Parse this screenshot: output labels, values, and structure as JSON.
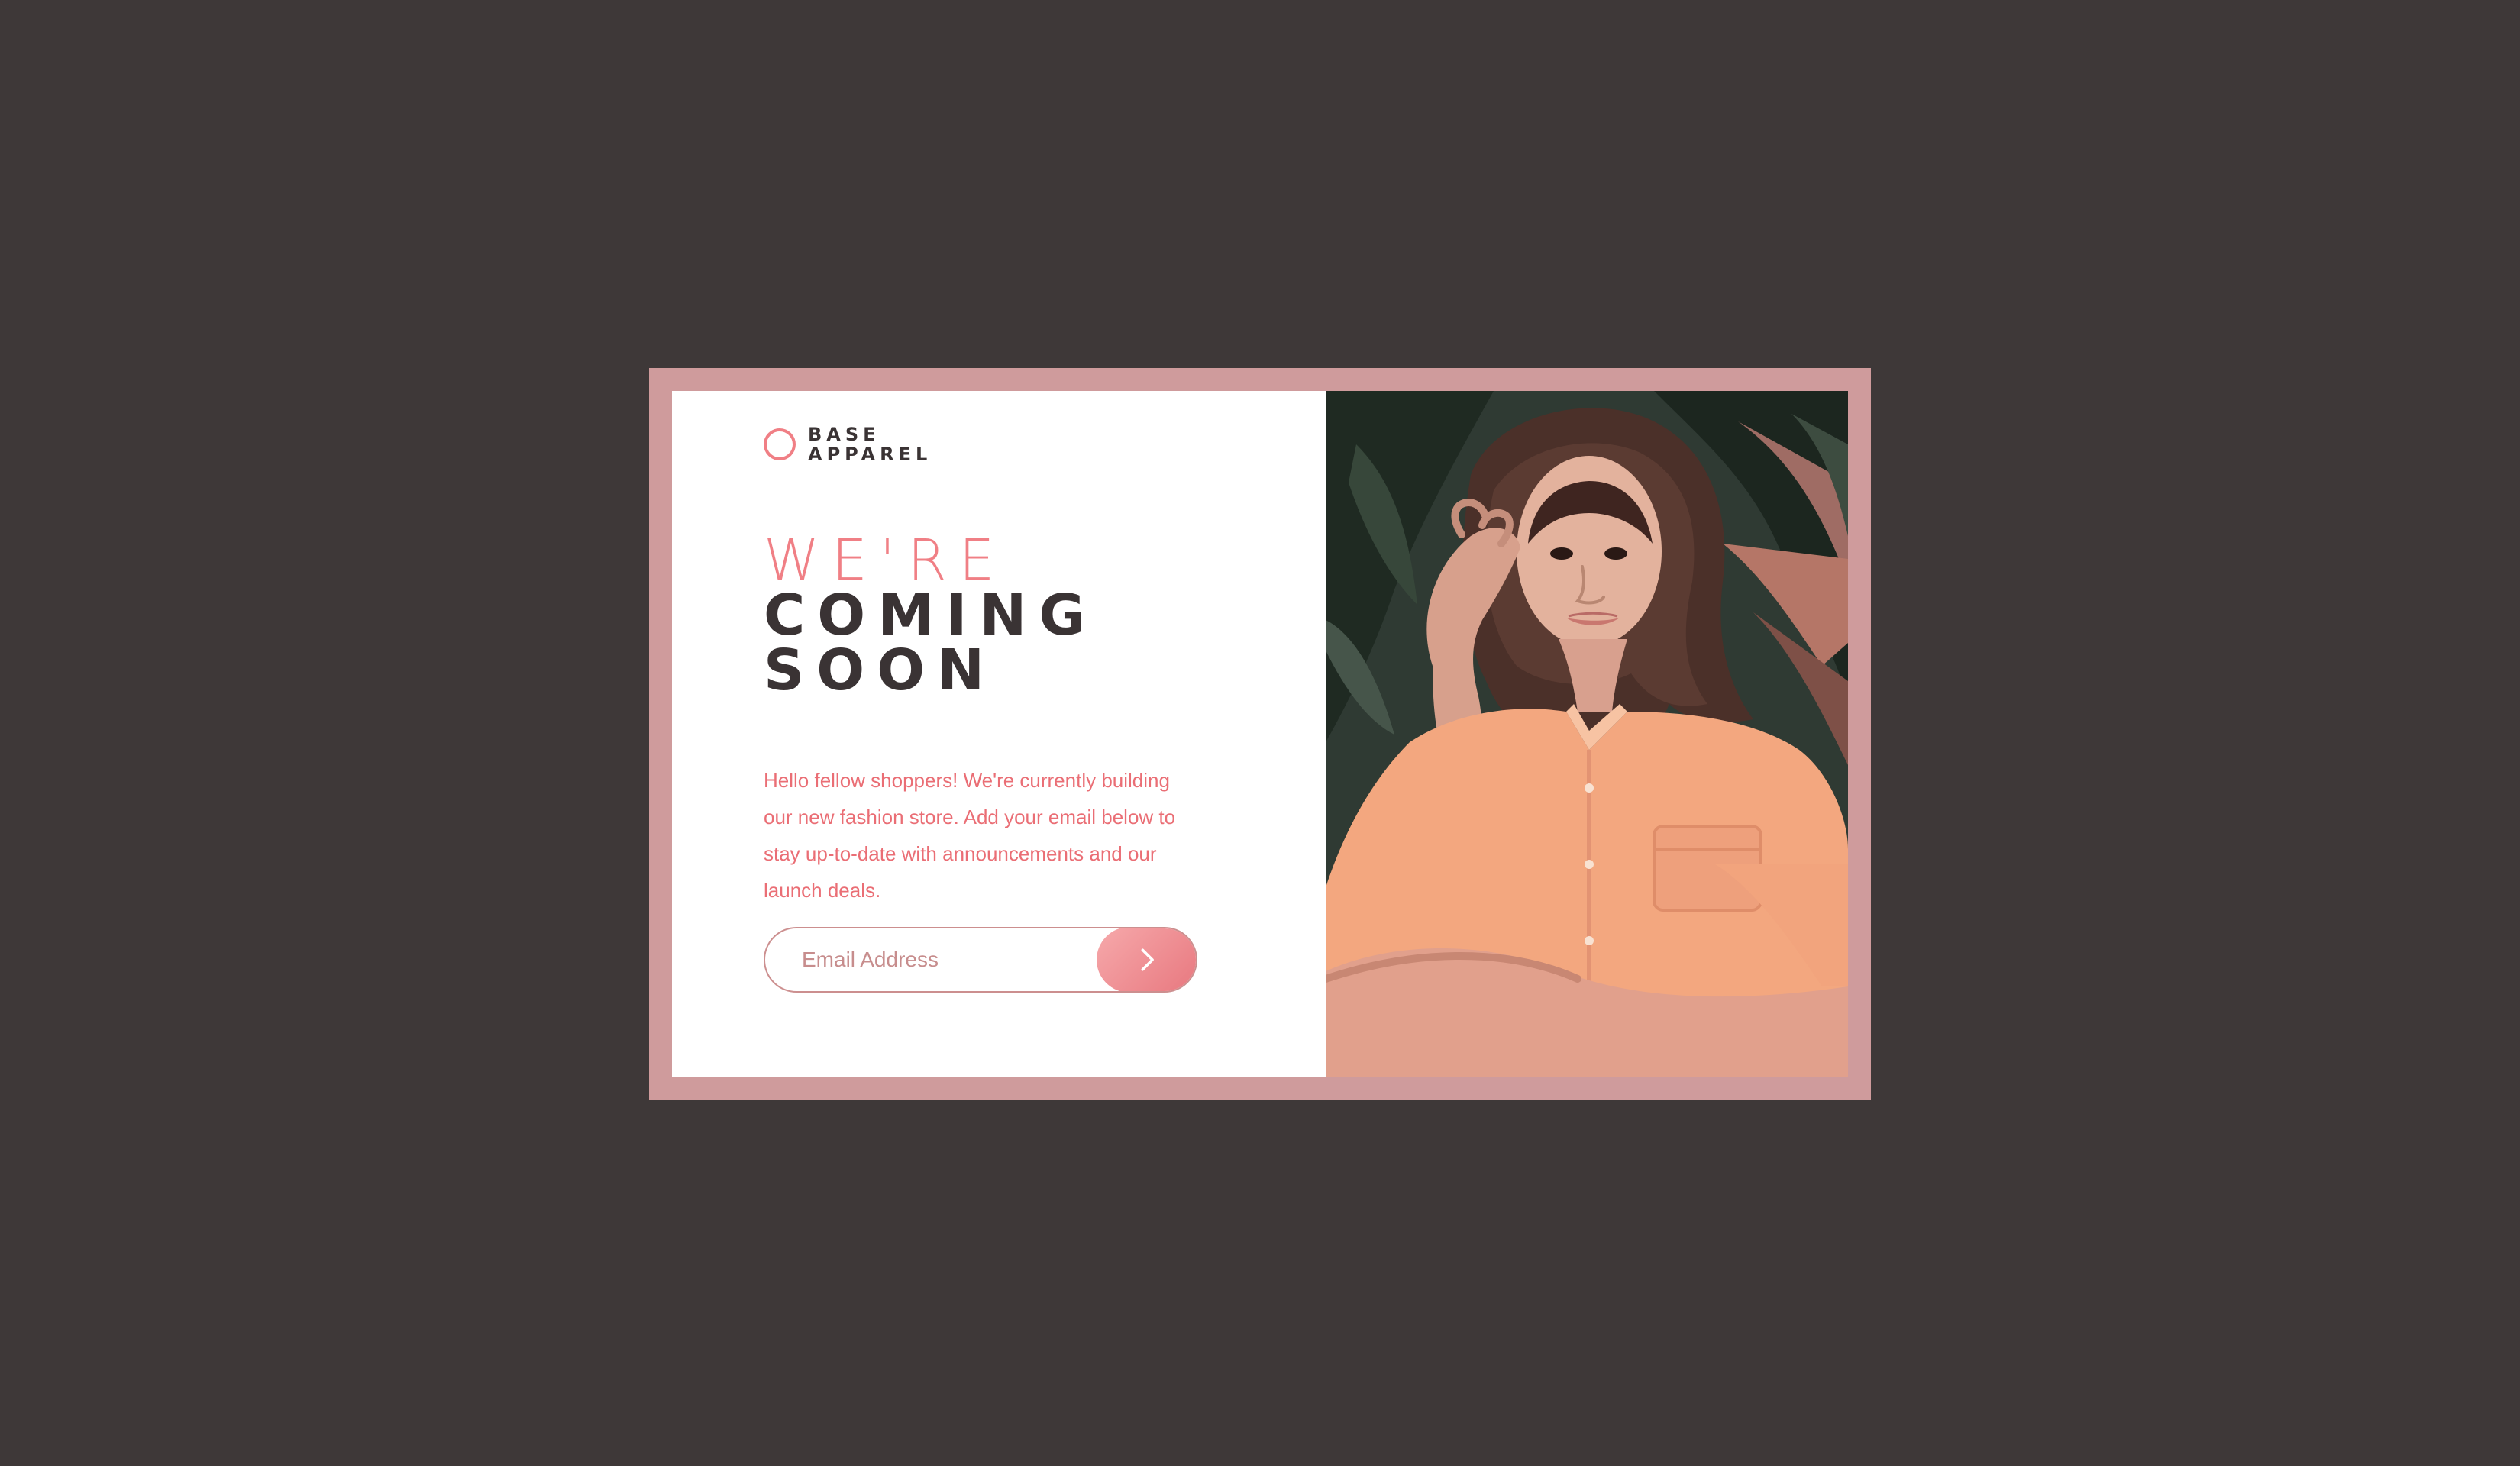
{
  "brand": {
    "line1": "BASE",
    "line2": "APPAREL"
  },
  "hero": {
    "line1": "WE'RE",
    "line2": "COMING",
    "line3": "SOON"
  },
  "description": "Hello fellow shoppers! We're currently building our new fashion store. Add your email below to stay up-to-date with announcements and our launch deals.",
  "form": {
    "email_placeholder": "Email Address",
    "submit_icon": "chevron-right-icon"
  },
  "colors": {
    "background": "#3e3838",
    "frame": "#cf9b9c",
    "accent": "#f07f85",
    "dark_text": "#3a3334"
  },
  "image": {
    "subject": "woman in peach shirt"
  }
}
